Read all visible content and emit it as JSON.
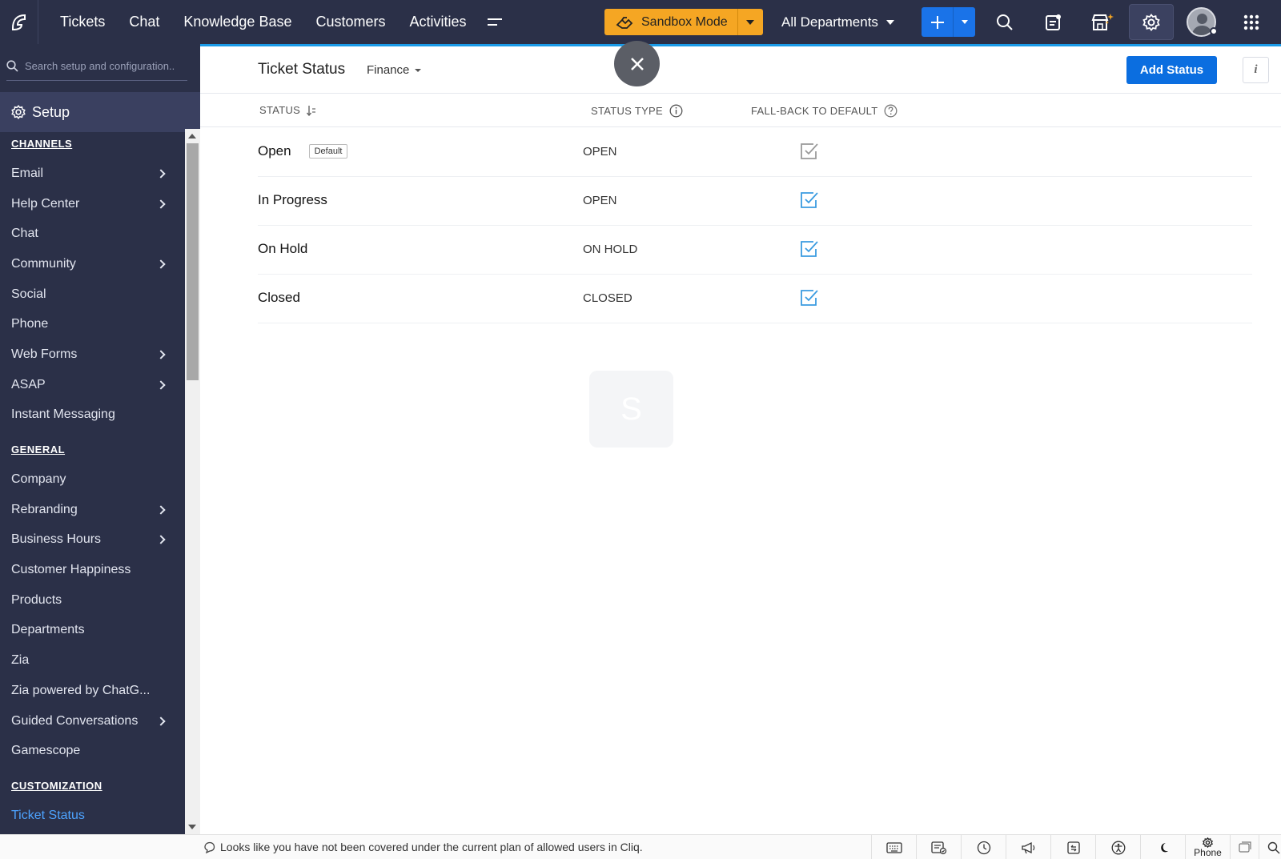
{
  "topnav": {
    "items": [
      {
        "name": "tickets",
        "label": "Tickets"
      },
      {
        "name": "chat",
        "label": "Chat"
      },
      {
        "name": "knowledge-base",
        "label": "Knowledge Base"
      },
      {
        "name": "customers",
        "label": "Customers"
      },
      {
        "name": "activities",
        "label": "Activities"
      }
    ],
    "sandbox_label": "Sandbox Mode",
    "departments_label": "All Departments",
    "icons": [
      "logo-icon",
      "more-menu-icon",
      "sandbox-icon",
      "plus-icon",
      "search-icon",
      "notes-icon",
      "marketplace-icon",
      "gear-icon",
      "apps-grid-icon"
    ]
  },
  "sidebar": {
    "search_placeholder": "Search setup and configuration..",
    "setup_label": "Setup",
    "sections": [
      {
        "title": "CHANNELS",
        "items": [
          {
            "label": "Email",
            "has_children": true
          },
          {
            "label": "Help Center",
            "has_children": true
          },
          {
            "label": "Chat",
            "has_children": false
          },
          {
            "label": "Community",
            "has_children": true
          },
          {
            "label": "Social",
            "has_children": false
          },
          {
            "label": "Phone",
            "has_children": false
          },
          {
            "label": "Web Forms",
            "has_children": true
          },
          {
            "label": "ASAP",
            "has_children": true
          },
          {
            "label": "Instant Messaging",
            "has_children": false
          }
        ]
      },
      {
        "title": "GENERAL",
        "items": [
          {
            "label": "Company",
            "has_children": false
          },
          {
            "label": "Rebranding",
            "has_children": true
          },
          {
            "label": "Business Hours",
            "has_children": true
          },
          {
            "label": "Customer Happiness",
            "has_children": false
          },
          {
            "label": "Products",
            "has_children": false
          },
          {
            "label": "Departments",
            "has_children": false
          },
          {
            "label": "Zia",
            "has_children": false
          },
          {
            "label": "Zia powered by ChatG...",
            "has_children": false
          },
          {
            "label": "Guided Conversations",
            "has_children": true
          },
          {
            "label": "Gamescope",
            "has_children": false
          }
        ]
      },
      {
        "title": "CUSTOMIZATION",
        "items": [
          {
            "label": "Ticket Status",
            "has_children": false,
            "active": true
          }
        ]
      }
    ]
  },
  "main": {
    "title": "Ticket Status",
    "department_filter": "Finance",
    "add_button": "Add Status",
    "info_label": "i",
    "columns": {
      "status": "STATUS",
      "status_type": "STATUS TYPE",
      "fallback": "FALL-BACK TO DEFAULT"
    },
    "rows": [
      {
        "name": "Open",
        "badge": "Default",
        "type": "OPEN",
        "fallback": true,
        "check_color": "#9a9a9a"
      },
      {
        "name": "In Progress",
        "badge": "",
        "type": "OPEN",
        "fallback": true,
        "check_color": "#3a9be0"
      },
      {
        "name": "On Hold",
        "badge": "",
        "type": "ON HOLD",
        "fallback": true,
        "check_color": "#3a9be0"
      },
      {
        "name": "Closed",
        "badge": "",
        "type": "CLOSED",
        "fallback": true,
        "check_color": "#3a9be0"
      }
    ],
    "ghost_letter": "S"
  },
  "bottombar": {
    "message": "Looks like you have not been covered under the current plan of allowed users in Cliq.",
    "phone_label": "Phone"
  },
  "colors": {
    "nav_bg": "#2b3048",
    "accent_blue": "#0b6ee0",
    "sandbox_orange": "#f5a623",
    "active_link": "#4da3ff"
  }
}
